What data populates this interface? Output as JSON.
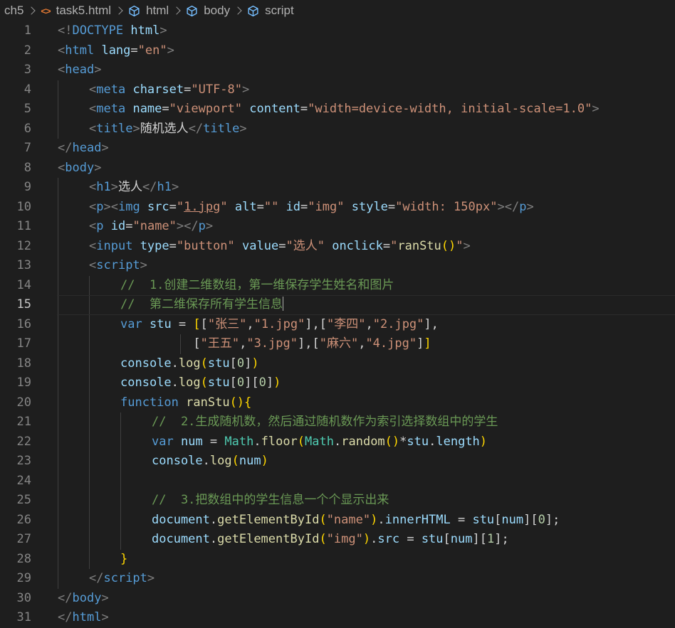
{
  "breadcrumb": {
    "folder": "ch5",
    "file": "task5.html",
    "path": [
      "html",
      "body",
      "script"
    ]
  },
  "editor": {
    "active_line": 15,
    "lines": [
      {
        "n": "1",
        "indent": 0,
        "t": [
          [
            "tb",
            "<!"
          ],
          [
            "tg",
            "DOCTYPE"
          ],
          [
            "ct",
            " "
          ],
          [
            "at",
            "html"
          ],
          [
            "tb",
            ">"
          ]
        ]
      },
      {
        "n": "2",
        "indent": 0,
        "t": [
          [
            "tb",
            "<"
          ],
          [
            "tg",
            "html"
          ],
          [
            "ct",
            " "
          ],
          [
            "at",
            "lang"
          ],
          [
            "ct",
            "="
          ],
          [
            "st",
            "\"en\""
          ],
          [
            "tb",
            ">"
          ]
        ]
      },
      {
        "n": "3",
        "indent": 0,
        "t": [
          [
            "tb",
            "<"
          ],
          [
            "tg",
            "head"
          ],
          [
            "tb",
            ">"
          ]
        ]
      },
      {
        "n": "4",
        "indent": 1,
        "t": [
          [
            "tb",
            "<"
          ],
          [
            "tg",
            "meta"
          ],
          [
            "ct",
            " "
          ],
          [
            "at",
            "charset"
          ],
          [
            "ct",
            "="
          ],
          [
            "st",
            "\"UTF-8\""
          ],
          [
            "tb",
            ">"
          ]
        ]
      },
      {
        "n": "5",
        "indent": 1,
        "t": [
          [
            "tb",
            "<"
          ],
          [
            "tg",
            "meta"
          ],
          [
            "ct",
            " "
          ],
          [
            "at",
            "name"
          ],
          [
            "ct",
            "="
          ],
          [
            "st",
            "\"viewport\""
          ],
          [
            "ct",
            " "
          ],
          [
            "at",
            "content"
          ],
          [
            "ct",
            "="
          ],
          [
            "st",
            "\"width=device-width, initial-scale=1.0\""
          ],
          [
            "tb",
            ">"
          ]
        ]
      },
      {
        "n": "6",
        "indent": 1,
        "t": [
          [
            "tb",
            "<"
          ],
          [
            "tg",
            "title"
          ],
          [
            "tb",
            ">"
          ],
          [
            "ct",
            "随机选人"
          ],
          [
            "tb",
            "</"
          ],
          [
            "tg",
            "title"
          ],
          [
            "tb",
            ">"
          ]
        ]
      },
      {
        "n": "7",
        "indent": 0,
        "t": [
          [
            "tb",
            "</"
          ],
          [
            "tg",
            "head"
          ],
          [
            "tb",
            ">"
          ]
        ]
      },
      {
        "n": "8",
        "indent": 0,
        "t": [
          [
            "tb",
            "<"
          ],
          [
            "tg",
            "body"
          ],
          [
            "tb",
            ">"
          ]
        ]
      },
      {
        "n": "9",
        "indent": 1,
        "t": [
          [
            "tb",
            "<"
          ],
          [
            "tg",
            "h1"
          ],
          [
            "tb",
            ">"
          ],
          [
            "ct",
            "选人"
          ],
          [
            "tb",
            "</"
          ],
          [
            "tg",
            "h1"
          ],
          [
            "tb",
            ">"
          ]
        ]
      },
      {
        "n": "10",
        "indent": 1,
        "t": [
          [
            "tb",
            "<"
          ],
          [
            "tg",
            "p"
          ],
          [
            "tb",
            "><"
          ],
          [
            "tg",
            "img"
          ],
          [
            "ct",
            " "
          ],
          [
            "at",
            "src"
          ],
          [
            "ct",
            "="
          ],
          [
            "st",
            "\""
          ],
          [
            "st ul",
            "1.jpg"
          ],
          [
            "st",
            "\""
          ],
          [
            "ct",
            " "
          ],
          [
            "at",
            "alt"
          ],
          [
            "ct",
            "="
          ],
          [
            "st",
            "\"\""
          ],
          [
            "ct",
            " "
          ],
          [
            "at",
            "id"
          ],
          [
            "ct",
            "="
          ],
          [
            "st",
            "\"img\""
          ],
          [
            "ct",
            " "
          ],
          [
            "at",
            "style"
          ],
          [
            "ct",
            "="
          ],
          [
            "st",
            "\"width: 150px\""
          ],
          [
            "tb",
            "></"
          ],
          [
            "tg",
            "p"
          ],
          [
            "tb",
            ">"
          ]
        ]
      },
      {
        "n": "11",
        "indent": 1,
        "t": [
          [
            "tb",
            "<"
          ],
          [
            "tg",
            "p"
          ],
          [
            "ct",
            " "
          ],
          [
            "at",
            "id"
          ],
          [
            "ct",
            "="
          ],
          [
            "st",
            "\"name\""
          ],
          [
            "tb",
            "></"
          ],
          [
            "tg",
            "p"
          ],
          [
            "tb",
            ">"
          ]
        ]
      },
      {
        "n": "12",
        "indent": 1,
        "t": [
          [
            "tb",
            "<"
          ],
          [
            "tg",
            "input"
          ],
          [
            "ct",
            " "
          ],
          [
            "at",
            "type"
          ],
          [
            "ct",
            "="
          ],
          [
            "st",
            "\"button\""
          ],
          [
            "ct",
            " "
          ],
          [
            "at",
            "value"
          ],
          [
            "ct",
            "="
          ],
          [
            "st",
            "\"选人\""
          ],
          [
            "ct",
            " "
          ],
          [
            "at",
            "onclick"
          ],
          [
            "ct",
            "="
          ],
          [
            "st",
            "\""
          ],
          [
            "fn",
            "ranStu"
          ],
          [
            "br",
            "()"
          ],
          [
            "st",
            "\""
          ],
          [
            "tb",
            ">"
          ]
        ]
      },
      {
        "n": "13",
        "indent": 1,
        "t": [
          [
            "tb",
            "<"
          ],
          [
            "tg",
            "script"
          ],
          [
            "tb",
            ">"
          ]
        ]
      },
      {
        "n": "14",
        "indent": 2,
        "t": [
          [
            "cm",
            "//  1.创建二维数组，第一维保存学生姓名和图片"
          ]
        ]
      },
      {
        "n": "15",
        "indent": 2,
        "t": [
          [
            "cm",
            "//  第二维保存所有学生信息"
          ]
        ],
        "cursor": true
      },
      {
        "n": "16",
        "indent": 2,
        "t": [
          [
            "kw",
            "var"
          ],
          [
            "ct",
            " "
          ],
          [
            "vr",
            "stu"
          ],
          [
            "ct",
            " = "
          ],
          [
            "br",
            "["
          ],
          [
            "ct",
            "["
          ],
          [
            "st",
            "\"张三\""
          ],
          [
            "ct",
            ","
          ],
          [
            "st",
            "\"1.jpg\""
          ],
          [
            "ct",
            "],["
          ],
          [
            "st",
            "\"李四\""
          ],
          [
            "ct",
            ","
          ],
          [
            "st",
            "\"2.jpg\""
          ],
          [
            "ct",
            "],"
          ]
        ]
      },
      {
        "n": "17",
        "indent": 2,
        "guides": [
          253
        ],
        "t": [
          [
            "ct",
            "          ["
          ],
          [
            "st",
            "\"王五\""
          ],
          [
            "ct",
            ","
          ],
          [
            "st",
            "\"3.jpg\""
          ],
          [
            "ct",
            "],["
          ],
          [
            "st",
            "\"麻六\""
          ],
          [
            "ct",
            ","
          ],
          [
            "st",
            "\"4.jpg\""
          ],
          [
            "ct",
            "]"
          ],
          [
            "br",
            "]"
          ]
        ]
      },
      {
        "n": "18",
        "indent": 2,
        "t": [
          [
            "vr",
            "console"
          ],
          [
            "ct",
            "."
          ],
          [
            "fn",
            "log"
          ],
          [
            "br",
            "("
          ],
          [
            "vr",
            "stu"
          ],
          [
            "ct",
            "["
          ],
          [
            "nm",
            "0"
          ],
          [
            "ct",
            "]"
          ],
          [
            "br",
            ")"
          ]
        ]
      },
      {
        "n": "19",
        "indent": 2,
        "t": [
          [
            "vr",
            "console"
          ],
          [
            "ct",
            "."
          ],
          [
            "fn",
            "log"
          ],
          [
            "br",
            "("
          ],
          [
            "vr",
            "stu"
          ],
          [
            "ct",
            "["
          ],
          [
            "nm",
            "0"
          ],
          [
            "ct",
            "]["
          ],
          [
            "nm",
            "0"
          ],
          [
            "ct",
            "]"
          ],
          [
            "br",
            ")"
          ]
        ]
      },
      {
        "n": "20",
        "indent": 2,
        "t": [
          [
            "kw",
            "function"
          ],
          [
            "ct",
            " "
          ],
          [
            "fn",
            "ranStu"
          ],
          [
            "br",
            "(){"
          ]
        ]
      },
      {
        "n": "21",
        "indent": 3,
        "t": [
          [
            "cm",
            "//  2.生成随机数，然后通过随机数作为索引选择数组中的学生"
          ]
        ]
      },
      {
        "n": "22",
        "indent": 3,
        "t": [
          [
            "kw",
            "var"
          ],
          [
            "ct",
            " "
          ],
          [
            "vr",
            "num"
          ],
          [
            "ct",
            " = "
          ],
          [
            "cl",
            "Math"
          ],
          [
            "ct",
            "."
          ],
          [
            "fn",
            "floor"
          ],
          [
            "br",
            "("
          ],
          [
            "cl",
            "Math"
          ],
          [
            "ct",
            "."
          ],
          [
            "fn",
            "random"
          ],
          [
            "br",
            "()"
          ],
          [
            "ct",
            "*"
          ],
          [
            "vr",
            "stu"
          ],
          [
            "ct",
            "."
          ],
          [
            "vr",
            "length"
          ],
          [
            "br",
            ")"
          ]
        ]
      },
      {
        "n": "23",
        "indent": 3,
        "t": [
          [
            "vr",
            "console"
          ],
          [
            "ct",
            "."
          ],
          [
            "fn",
            "log"
          ],
          [
            "br",
            "("
          ],
          [
            "vr",
            "num"
          ],
          [
            "br",
            ")"
          ]
        ]
      },
      {
        "n": "24",
        "indent": 3,
        "t": []
      },
      {
        "n": "25",
        "indent": 3,
        "t": [
          [
            "cm",
            "//  3.把数组中的学生信息一个个显示出来"
          ]
        ]
      },
      {
        "n": "26",
        "indent": 3,
        "t": [
          [
            "vr",
            "document"
          ],
          [
            "ct",
            "."
          ],
          [
            "fn",
            "getElementById"
          ],
          [
            "br",
            "("
          ],
          [
            "st",
            "\"name\""
          ],
          [
            "br",
            ")"
          ],
          [
            "ct",
            "."
          ],
          [
            "vr",
            "innerHTML"
          ],
          [
            "ct",
            " = "
          ],
          [
            "vr",
            "stu"
          ],
          [
            "ct",
            "["
          ],
          [
            "vr",
            "num"
          ],
          [
            "ct",
            "]["
          ],
          [
            "nm",
            "0"
          ],
          [
            "ct",
            "];"
          ]
        ]
      },
      {
        "n": "27",
        "indent": 3,
        "t": [
          [
            "vr",
            "document"
          ],
          [
            "ct",
            "."
          ],
          [
            "fn",
            "getElementById"
          ],
          [
            "br",
            "("
          ],
          [
            "st",
            "\"img\""
          ],
          [
            "br",
            ")"
          ],
          [
            "ct",
            "."
          ],
          [
            "vr",
            "src"
          ],
          [
            "ct",
            " = "
          ],
          [
            "vr",
            "stu"
          ],
          [
            "ct",
            "["
          ],
          [
            "vr",
            "num"
          ],
          [
            "ct",
            "]["
          ],
          [
            "nm",
            "1"
          ],
          [
            "ct",
            "];"
          ]
        ]
      },
      {
        "n": "28",
        "indent": 2,
        "t": [
          [
            "br",
            "}"
          ]
        ]
      },
      {
        "n": "29",
        "indent": 1,
        "t": [
          [
            "tb",
            "</"
          ],
          [
            "tg",
            "script"
          ],
          [
            "tb",
            ">"
          ]
        ]
      },
      {
        "n": "30",
        "indent": 0,
        "t": [
          [
            "tb",
            "</"
          ],
          [
            "tg",
            "body"
          ],
          [
            "tb",
            ">"
          ]
        ]
      },
      {
        "n": "31",
        "indent": 0,
        "t": [
          [
            "tb",
            "</"
          ],
          [
            "tg",
            "html"
          ],
          [
            "tb",
            ">"
          ]
        ]
      }
    ]
  }
}
